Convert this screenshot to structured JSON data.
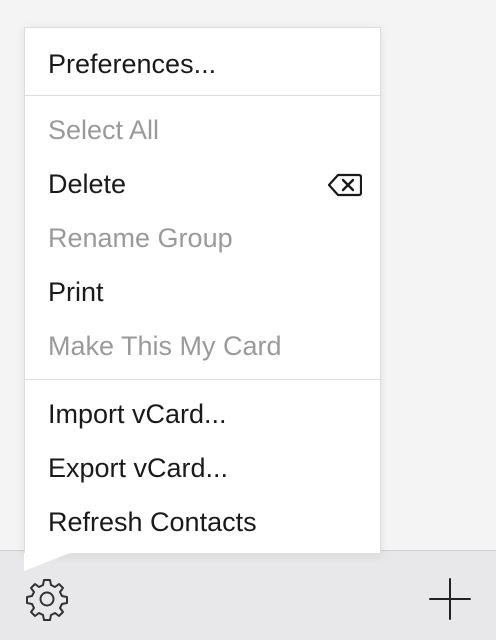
{
  "menu": {
    "items": [
      {
        "label": "Preferences...",
        "enabled": true
      },
      {
        "label": "Select All",
        "enabled": false
      },
      {
        "label": "Delete",
        "enabled": true,
        "shortcut_icon": "delete-backspace-icon"
      },
      {
        "label": "Rename Group",
        "enabled": false
      },
      {
        "label": "Print",
        "enabled": true
      },
      {
        "label": "Make This My Card",
        "enabled": false
      },
      {
        "label": "Import vCard...",
        "enabled": true
      },
      {
        "label": "Export vCard...",
        "enabled": true
      },
      {
        "label": "Refresh Contacts",
        "enabled": true
      }
    ]
  },
  "toolbar": {
    "gear_icon": "gear-icon",
    "add_icon": "plus-icon"
  },
  "colors": {
    "enabled_text": "#1a1a1a",
    "disabled_text": "#9a9a9a",
    "menu_background": "#ffffff",
    "bar_background": "#e8e8ea"
  }
}
